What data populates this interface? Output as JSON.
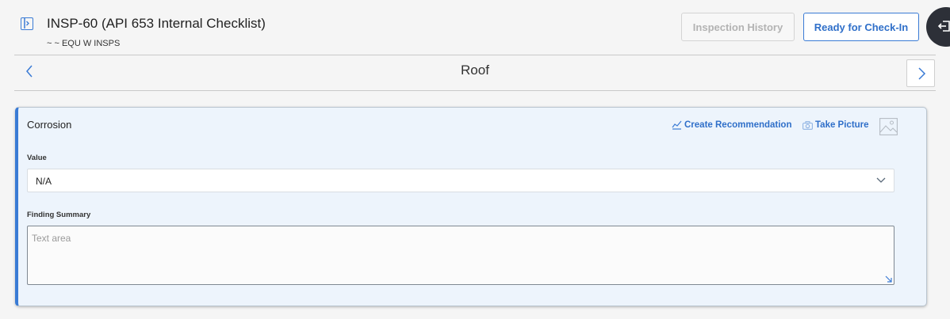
{
  "header": {
    "title": "INSP-60 (API 653 Internal Checklist)",
    "subtitle": "~ ~ EQU W INSPS",
    "inspection_history_label": "Inspection History",
    "ready_checkin_label": "Ready for Check-In"
  },
  "section": {
    "title": "Roof"
  },
  "card": {
    "title": "Corrosion",
    "create_recommendation_label": "Create Recommendation",
    "take_picture_label": "Take Picture",
    "value_label": "Value",
    "value_selected": "N/A",
    "finding_summary_label": "Finding Summary",
    "finding_summary_placeholder": "Text area"
  },
  "colors": {
    "accent": "#3a7bd5",
    "card_background": "#edf4fc",
    "page_background": "#f5f5f5",
    "disabled_text": "#b3b3b3"
  },
  "icons": [
    "panel-toggle-icon",
    "chevron-left-icon",
    "chevron-right-icon",
    "chevron-down-icon",
    "recommendation-icon",
    "camera-icon",
    "image-icon",
    "resize-handle-icon",
    "exit-icon"
  ]
}
